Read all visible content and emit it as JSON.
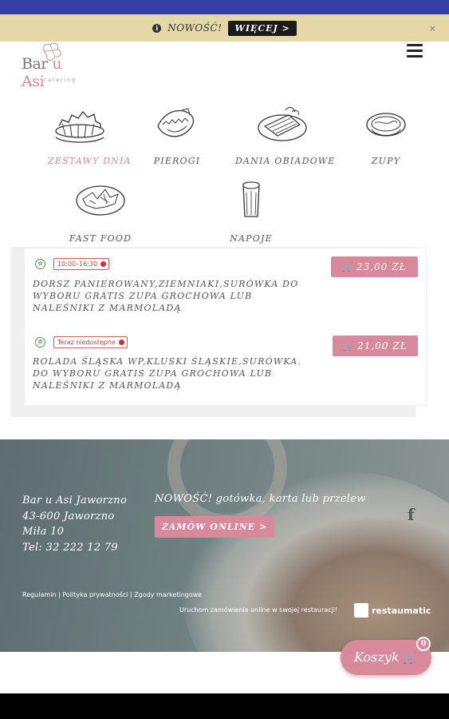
{
  "announcement": {
    "text": "NOWOŚĆ!",
    "button_label": "WIĘCEJ >",
    "close": "×"
  },
  "logo": {
    "name_part1": "Bar",
    "name_part2": "u",
    "name_part3": "Asi",
    "subtitle": "catering"
  },
  "categories": [
    {
      "label": "ZESTAWY DNIA",
      "icon": "dishes-set-icon",
      "active": true
    },
    {
      "label": "PIEROGI",
      "icon": "dumpling-icon",
      "active": false
    },
    {
      "label": "DANIA OBIADOWE",
      "icon": "dinner-plate-icon",
      "active": false
    },
    {
      "label": "ZUPY",
      "icon": "soup-bowl-icon",
      "active": false
    },
    {
      "label": "FAST FOOD",
      "icon": "fast-food-plate-icon",
      "active": false
    },
    {
      "label": "NAPOJE",
      "icon": "beer-glass-icon",
      "active": false
    }
  ],
  "menu_items": [
    {
      "availability": "10:00–16:30",
      "description": "DORSZ PANIEROWANY,ZIEMNIAKI,SURÓWKA DO WYBORU GRATIS ZUPA GROCHOWA LUB NALEŚNIKI Z MARMOLADĄ",
      "price": "23,00 ZŁ"
    },
    {
      "availability": "Teraz niedostępne",
      "description": "ROLADA ŚLĄSKA WP,KLUSKI ŚLĄSKIE,SURÓWKA. DO WYBORU GRATIS ZUPA GROCHOWA LUB NALEŚNIKI Z MARMOLADĄ",
      "price": "21,00 ZŁ"
    }
  ],
  "footer": {
    "address_name": "Bar u Asi Jaworzno",
    "address_city": "43-600 Jaworzno",
    "address_street": "Miła 10",
    "address_phone": "Tel: 32 222 12 79",
    "payment_text": "NOWOŚĆ! gotówka, karta lub przelew",
    "order_button": "ZAMÓW ONLINE >",
    "facebook": "f",
    "links": "Regulamin | Polityka prywatności | Zgody marketingowe",
    "powered_text": "Uruchom zamówienia online w swojej restauracji!",
    "brand": "restaumatic"
  },
  "basket": {
    "label": "Koszyk",
    "count": "0"
  },
  "colors": {
    "accent": "#d88a9c",
    "status_bar": "#3340a6",
    "announcement_bg": "#e6d7a8"
  }
}
